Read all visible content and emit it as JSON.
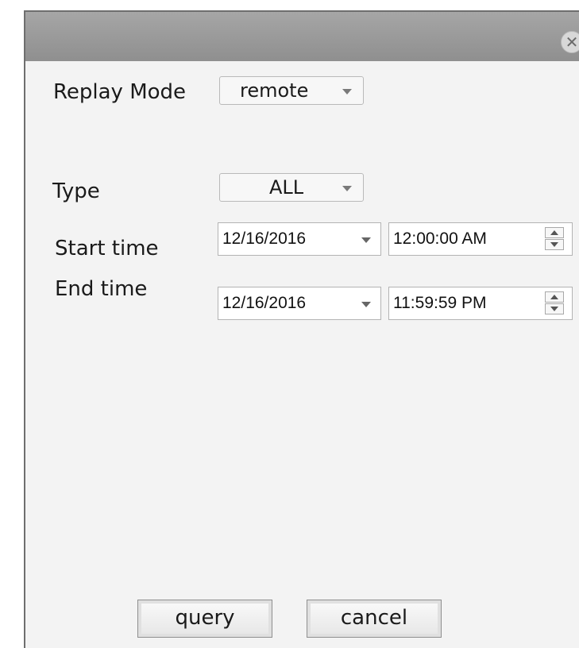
{
  "dialog": {
    "close_icon_glyph": "✕"
  },
  "replay_mode": {
    "label": "Replay Mode",
    "value": "remote"
  },
  "type": {
    "label": "Type",
    "value": "ALL"
  },
  "start_time": {
    "label": "Start time",
    "date": "12/16/2016",
    "time": "12:00:00 AM"
  },
  "end_time": {
    "label": "End time",
    "date": "12/16/2016",
    "time": "11:59:59 PM"
  },
  "buttons": {
    "query": "query",
    "cancel": "cancel"
  }
}
